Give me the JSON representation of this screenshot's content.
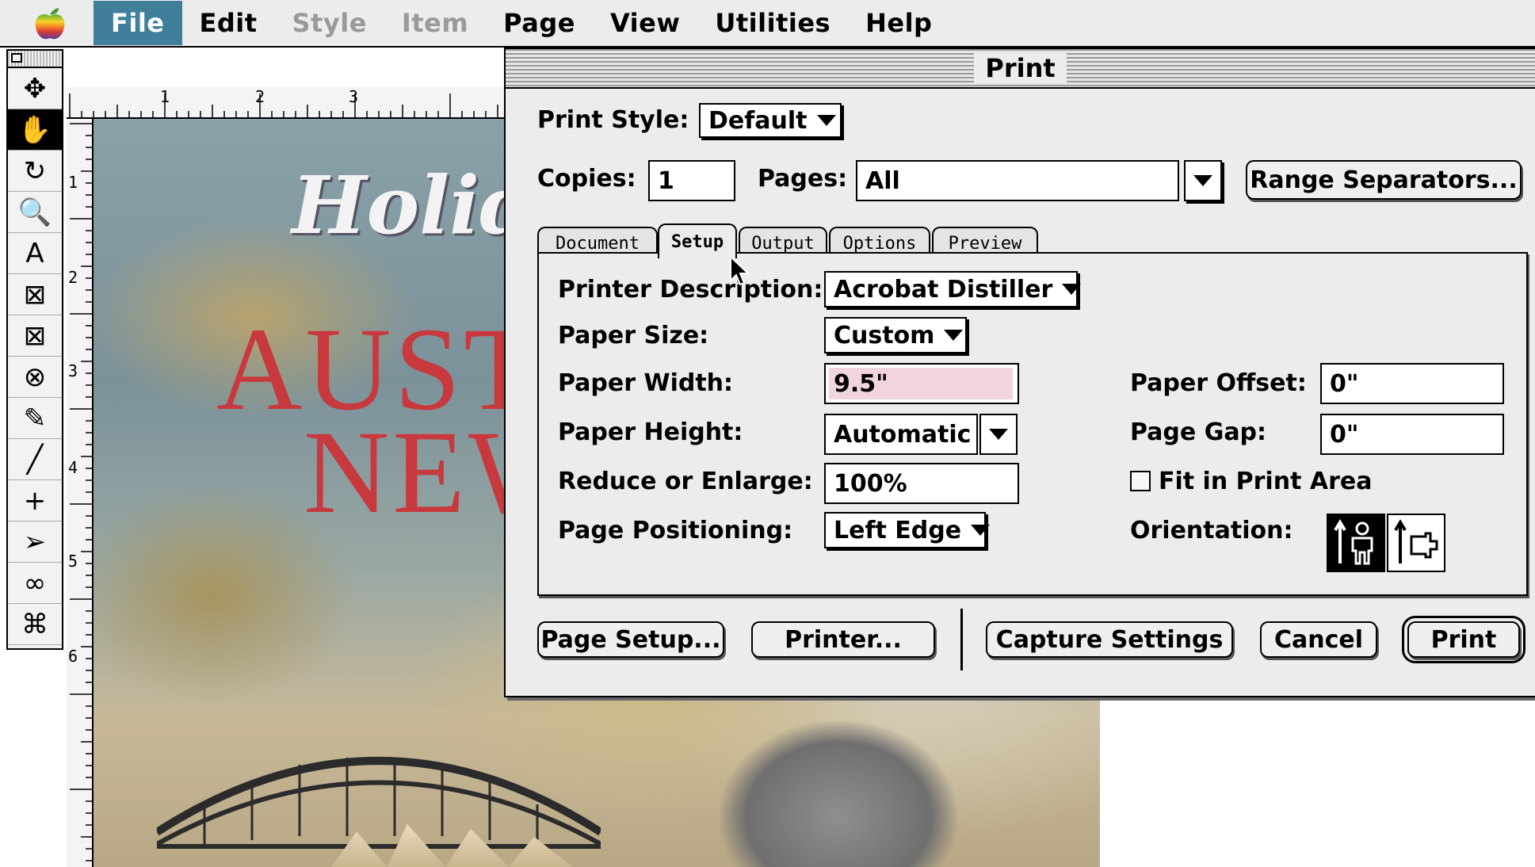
{
  "menubar": {
    "items": [
      {
        "label": "File",
        "state": "active"
      },
      {
        "label": "Edit",
        "state": "normal"
      },
      {
        "label": "Style",
        "state": "disabled"
      },
      {
        "label": "Item",
        "state": "disabled"
      },
      {
        "label": "Page",
        "state": "normal"
      },
      {
        "label": "View",
        "state": "normal"
      },
      {
        "label": "Utilities",
        "state": "normal"
      },
      {
        "label": "Help",
        "state": "normal"
      }
    ]
  },
  "tools": [
    {
      "icon": "move-icon",
      "glyph": "✥"
    },
    {
      "icon": "grabber-hand-icon",
      "glyph": "✋",
      "selected": true
    },
    {
      "icon": "rotate-icon",
      "glyph": "↻"
    },
    {
      "icon": "zoom-icon",
      "glyph": "🔍"
    },
    {
      "icon": "text-box-icon",
      "glyph": "A"
    },
    {
      "icon": "picture-box-icon",
      "glyph": "⊠"
    },
    {
      "icon": "rounded-picture-box-icon",
      "glyph": "⊠"
    },
    {
      "icon": "oval-picture-box-icon",
      "glyph": "⊗"
    },
    {
      "icon": "bezier-picture-box-icon",
      "glyph": "✎"
    },
    {
      "icon": "line-icon",
      "glyph": "╱"
    },
    {
      "icon": "orthogonal-line-icon",
      "glyph": "+"
    },
    {
      "icon": "text-path-icon",
      "glyph": "➢"
    },
    {
      "icon": "link-icon",
      "glyph": "∞"
    },
    {
      "icon": "unlink-icon",
      "glyph": "⌘"
    }
  ],
  "ruler": {
    "top_numbers": [
      "1",
      "2",
      "3"
    ],
    "left_numbers": [
      "1",
      "2",
      "3",
      "4",
      "5",
      "6"
    ]
  },
  "document": {
    "holiday_text": "Holida",
    "aus_text": "AUSTR",
    "new_text": "NEW"
  },
  "dialog": {
    "title": "Print",
    "print_style_label": "Print Style:",
    "print_style_value": "Default",
    "copies_label": "Copies:",
    "copies_value": "1",
    "pages_label": "Pages:",
    "pages_value": "All",
    "range_button": "Range Separators...",
    "tabs": [
      "Document",
      "Setup",
      "Output",
      "Options",
      "Preview"
    ],
    "active_tab": "Setup",
    "setup": {
      "printer_desc_label": "Printer Description:",
      "printer_desc_value": "Acrobat Distiller",
      "paper_size_label": "Paper Size:",
      "paper_size_value": "Custom",
      "paper_width_label": "Paper Width:",
      "paper_width_value": "9.5\"",
      "paper_height_label": "Paper Height:",
      "paper_height_value": "Automatic",
      "reduce_label": "Reduce or Enlarge:",
      "reduce_value": "100%",
      "positioning_label": "Page Positioning:",
      "positioning_value": "Left Edge",
      "paper_offset_label": "Paper Offset:",
      "paper_offset_value": "0\"",
      "page_gap_label": "Page Gap:",
      "page_gap_value": "0\"",
      "fit_label": "Fit in Print Area",
      "fit_checked": false,
      "orientation_label": "Orientation:",
      "orientation_selected": "portrait"
    },
    "buttons": {
      "page_setup": "Page Setup...",
      "printer": "Printer...",
      "capture": "Capture Settings",
      "cancel": "Cancel",
      "print": "Print"
    }
  },
  "colors": {
    "menu_highlight": "#3f7f9c",
    "paper_width_highlight": "#f2d4e0",
    "headline_red": "#c8393e"
  }
}
